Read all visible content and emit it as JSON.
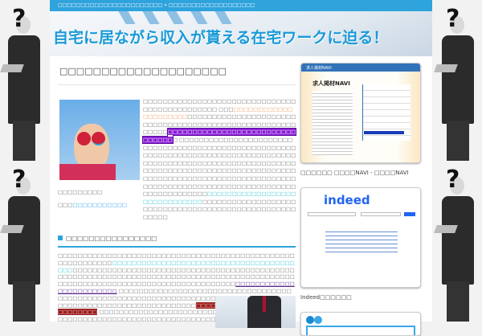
{
  "topbar": {
    "breadcrumb": "□□□□□□□□□□□□□□□□□□□□□□□ » □□□□□□□□□□□□□□□□□□□"
  },
  "banner": {
    "title": "自宅に居ながら収入が貰える在宅ワークに迫る！"
  },
  "article": {
    "title": "□□□□□□□□□□□□□□□□□□□□",
    "p1": [
      "□□□□□□□□□□□□□□□□□□□□□□□□□□□□□□□□□□□□□□□□□□□□□□ □□□"
    ],
    "link_orange": "□□□□□□□□□□□□□□□□□□□□□",
    "t2": "□□□□□□□□□□□□□□□□□□□□□□□□□□□□□□□□□□□□□□□□□□□□□□□□□□□□□□□□□□",
    "hl_purple": "□□□□□□□□□□□□□□□□□□□□□□□□□□□□□□□□",
    "t3": "□ □□□□□",
    "t4": "□□□□□□□□□□□□□□□□□□□□□□□□□□□□□□□□□□□□□□□□□□□□□□□□□□□□□",
    "t5": "□□□□□□□□□□□□□□□□□□□□□□□□□□□□□□□□□□□□□□□□□□□□□□□□□□□□□□□□□□□□□□□□□□□□□□□□□□□□□□□□□□□□□□□□□□□□□□□□□□□□□□□□□□□□□□□□□□□□□□□□□□□□□□□□□□□□□□□□□□□□□□□□□□□□□□□□□□□□□□□□",
    "t6": "□□□□",
    "link_cyan": "□□□□□□□□□□□□□□□□□□□□□□□□□□□□□□",
    "t7": "□□□□□□□□□□□□□□□□□□□□□□□□□□□□□□□□□□□□□□□□□□□□□□□□□□□□□□□",
    "t8": "□□□□□□□□□",
    "t9": "□□□",
    "link_blue": "□□□□□□□□□□□"
  },
  "section": {
    "heading": "□□□□□□□□□□□□□□□□",
    "s1": "□□□□□□□□□□□□□□□□□□□□□□□□□□□□□□□□□□□□□□□□□□□□□□□□□□□□□□□□",
    "s2": "□□□",
    "link_cyan": "□□□□□□□□□□□□□□□□□□□□□□□□□□□□□□□□□□□□□□□□",
    "s3": "□□□□□□□□□□□□□□□□□□□□□□□□□□□□□□□□□□□□□□□□□□□□□□□□□□□□□□□□□□□□□□□□□□□□□□□□□□□□□□□□□□□□□□□□□□□□□□□□□□□□□□□□□□□□□□□□□□□□□□□□□□□□□□□□□",
    "link_purple": "□□□□□□□□□□□□□□□□□□□□□□□□",
    "s4": " □□□□□□□□□□□□□□□□□□□□□□□□□□□□□□□□□□□□□□□□□□□□□□□□□□□□□□□□□□□□□□□□□□□□□□□□□□□□□□□□□□□□□□□□□□□□□□□□□□□□□□□□□□□□□□□",
    "hl_red": "□□□□□□□□□□□□□□□□□□□□□□□□□□□□",
    "s5": " □",
    "s6": "□□□□□□□□□□□□□□□□□□□□□□□□□□□□□□□□□□□□□□□□□□□□□□□□□□□□□□□□□□□□□□□□□□□□□□□□□□□□□□□□□"
  },
  "sidebar": {
    "shot1_title": "求人掲材NAVI",
    "caption1": "□□□□□□ □□□□NAVI - □□□□NAVI",
    "shot2_logo": "indeed",
    "caption2": "Indeed□□□□□□"
  }
}
